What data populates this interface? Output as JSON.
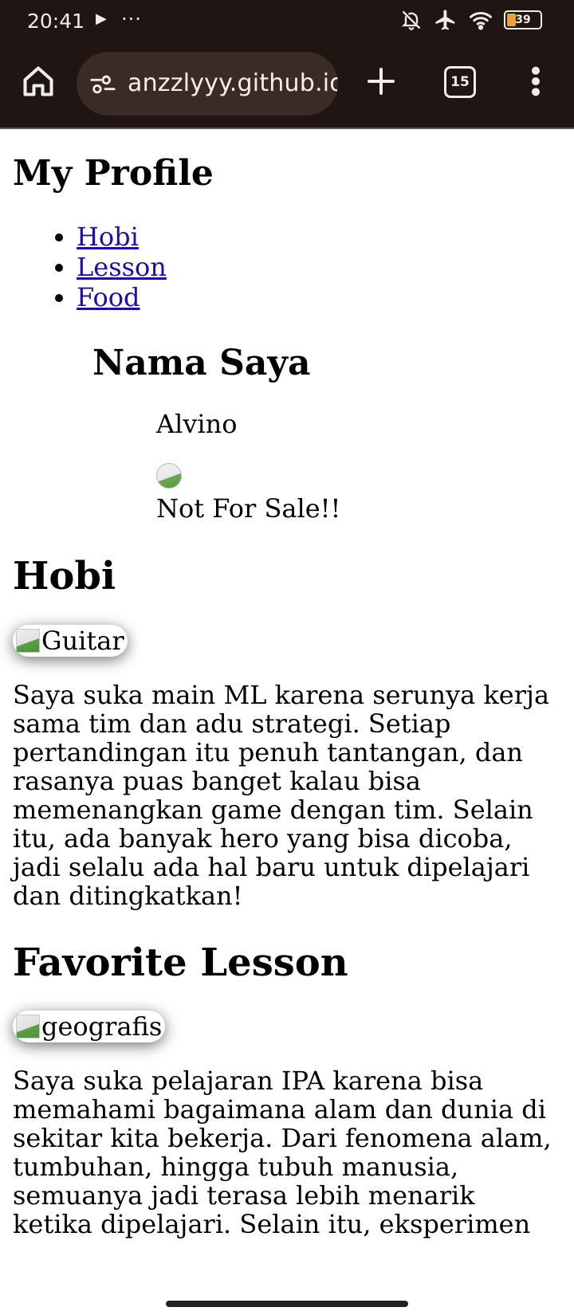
{
  "status_bar": {
    "time": "20:41",
    "play_icon": "▶",
    "more": "···",
    "battery": "39",
    "icons": [
      "bell-off-icon",
      "airplane-icon",
      "wifi-icon",
      "battery-icon"
    ],
    "battery_color": "#e8a33c"
  },
  "browser": {
    "url": "anzzlyyy.github.io",
    "tab_count": "15",
    "icons": [
      "home-icon",
      "site-settings-icon",
      "plus-icon",
      "tabs-icon",
      "overflow-menu-icon"
    ]
  },
  "page": {
    "title": "My Profile",
    "nav": [
      "Hobi",
      "Lesson",
      "Food"
    ],
    "name_heading": "Nama Saya",
    "name_value": "Alvino",
    "sale_text": "Not For Sale!!",
    "hobi": {
      "heading": "Hobi",
      "img_alt": "Guitar",
      "text": "Saya suka main ML karena serunya kerja sama tim dan adu strategi. Setiap pertandingan itu penuh tantangan, dan rasanya puas banget kalau bisa memenangkan game dengan tim. Selain itu, ada banyak hero yang bisa dicoba, jadi selalu ada hal baru untuk dipelajari dan ditingkatkan!"
    },
    "lesson": {
      "heading": "Favorite Lesson",
      "img_alt": "geografis",
      "text": "Saya suka pelajaran IPA karena bisa memahami bagaimana alam dan dunia di sekitar kita bekerja. Dari fenomena alam, tumbuhan, hingga tubuh manusia, semuanya jadi terasa lebih menarik ketika dipelajari. Selain itu, eksperimen"
    },
    "link_color": "#1a0dab"
  }
}
